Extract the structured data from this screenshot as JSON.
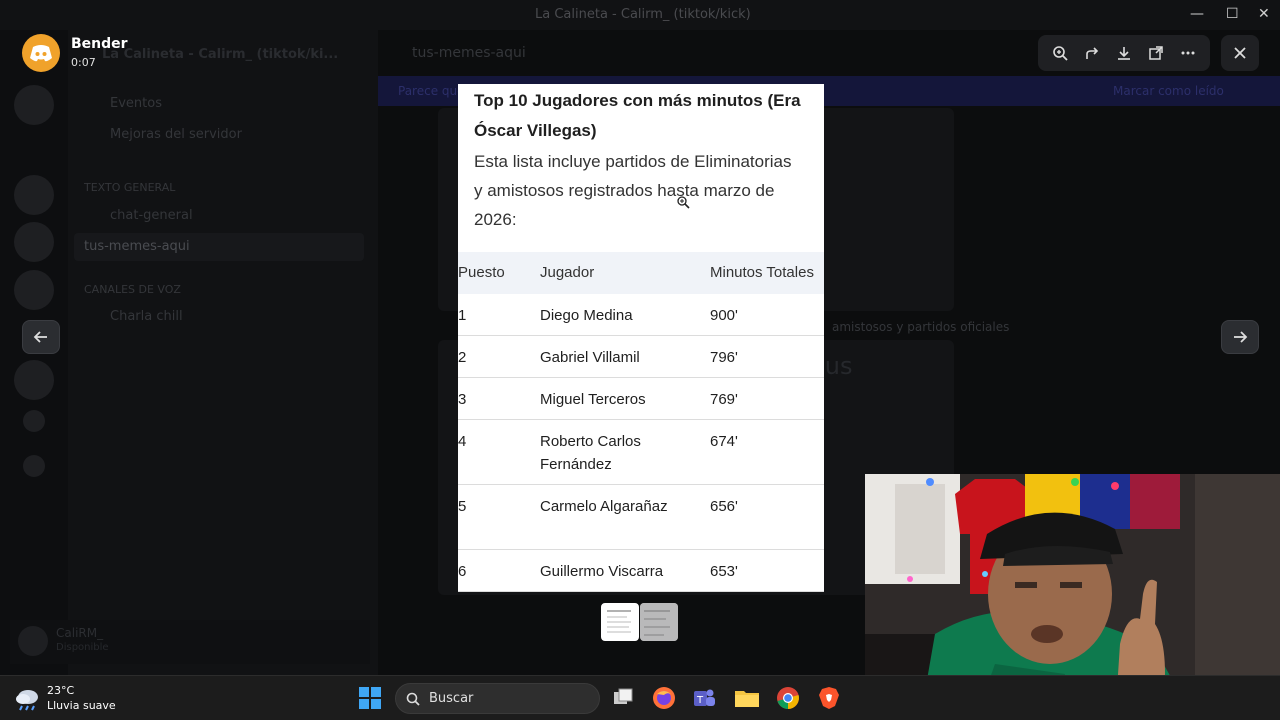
{
  "background": {
    "window_title": "La Calineta - Calirm_ (tiktok/kick)",
    "server_name": "La Calineta - Calirm_ (tiktok/ki...",
    "channel_header": "tus-memes-aqui",
    "channels": [
      "Eventos",
      "Mejoras del servidor",
      "TEXTO GENERAL",
      "chat-general",
      "tus-memes-aqui",
      "CANALES DE VOZ",
      "Charla chill"
    ],
    "user_panel": {
      "name": "CaliRM_",
      "status": "Disponible"
    },
    "banner_left": "Parece que...",
    "banner_right": "Marcar como leído",
    "card_texts": [
      "amistosos y partidos oficiales",
      "eus"
    ]
  },
  "overlay": {
    "user": {
      "name": "Bender",
      "elapsed": "0:07"
    },
    "toolbar": {
      "zoom_icon": "zoom-in-icon",
      "forward_icon": "forward-icon",
      "download_icon": "download-icon",
      "open_icon": "open-external-icon",
      "more_icon": "more-icon",
      "close_icon": "close-icon"
    }
  },
  "document": {
    "title": "Top 10 Jugadores con más minutos (Era Óscar Villegas)",
    "intro": "Esta lista incluye partidos de Eliminatorias y amistosos registrados hasta marzo de 2026:",
    "columns": [
      "Puesto",
      "Jugador",
      "Minutos Totales"
    ],
    "rows": [
      {
        "rank": "1",
        "player": "Diego Medina",
        "minutes": "900'"
      },
      {
        "rank": "2",
        "player": "Gabriel Villamil",
        "minutes": "796'"
      },
      {
        "rank": "3",
        "player": "Miguel Terceros",
        "minutes": "769'"
      },
      {
        "rank": "4",
        "player": "Roberto Carlos Fernández",
        "minutes": "674'"
      },
      {
        "rank": "5",
        "player": "Carmelo Algarañaz",
        "minutes": "656'"
      },
      {
        "rank": "6",
        "player": "Guillermo Viscarra",
        "minutes": "653'"
      }
    ]
  },
  "taskbar": {
    "weather_temp": "23°C",
    "weather_desc": "Lluvia suave",
    "search_label": "Buscar"
  },
  "colors": {
    "accent_logo": "#f0a22b",
    "discord_blurple": "#5865f2",
    "doc_header_bg": "#f0f3f8"
  }
}
